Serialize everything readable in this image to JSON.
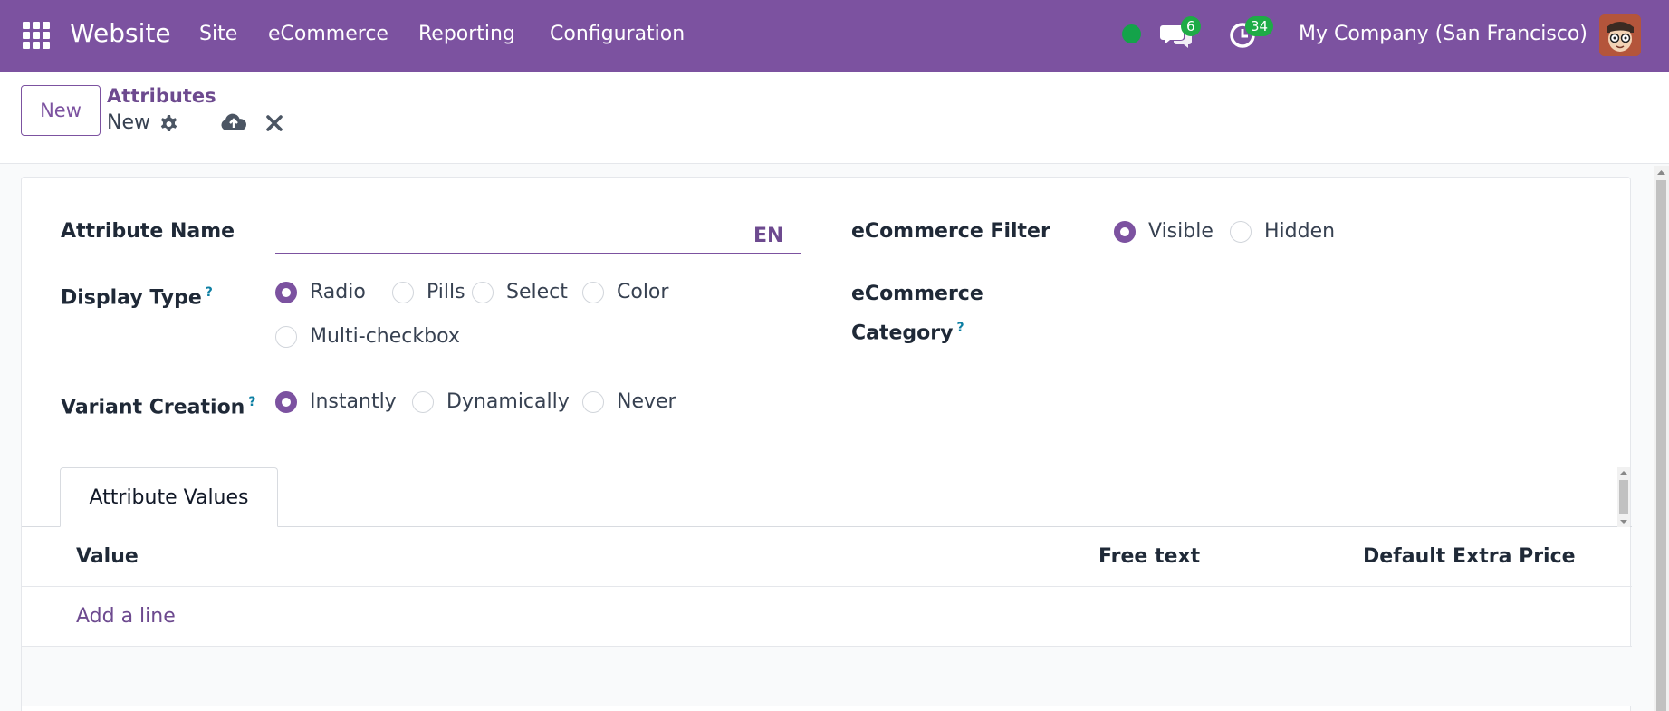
{
  "topnav": {
    "app_title": "Website",
    "menu": [
      "Site",
      "eCommerce",
      "Reporting",
      "Configuration"
    ],
    "messages_count": "6",
    "activities_count": "34",
    "company": "My Company (San Francisco)",
    "bg_color": "#7c52a0"
  },
  "control": {
    "new_label": "New",
    "breadcrumb_parent": "Attributes",
    "breadcrumb_current": "New"
  },
  "form": {
    "attribute_name_label": "Attribute Name",
    "attribute_name_value": "",
    "lang": "EN",
    "display_type_label": "Display Type",
    "display_type_options": [
      "Radio",
      "Pills",
      "Select",
      "Color",
      "Multi-checkbox"
    ],
    "display_type_selected": "Radio",
    "variant_creation_label": "Variant Creation",
    "variant_creation_options": [
      "Instantly",
      "Dynamically",
      "Never"
    ],
    "variant_creation_selected": "Instantly",
    "ecommerce_filter_label": "eCommerce Filter",
    "ecommerce_filter_options": [
      "Visible",
      "Hidden"
    ],
    "ecommerce_filter_selected": "Visible",
    "ecommerce_category_label_line1": "eCommerce",
    "ecommerce_category_label_line2": "Category",
    "help_mark": "?"
  },
  "values_tab": {
    "tab_label": "Attribute Values",
    "columns": [
      "Value",
      "Free text",
      "Default Extra Price"
    ],
    "add_line": "Add a line"
  },
  "colors": {
    "accent": "#7c52a0",
    "link": "#6d4a8f",
    "status_online": "#14a34a",
    "badge": "#1eab46"
  }
}
